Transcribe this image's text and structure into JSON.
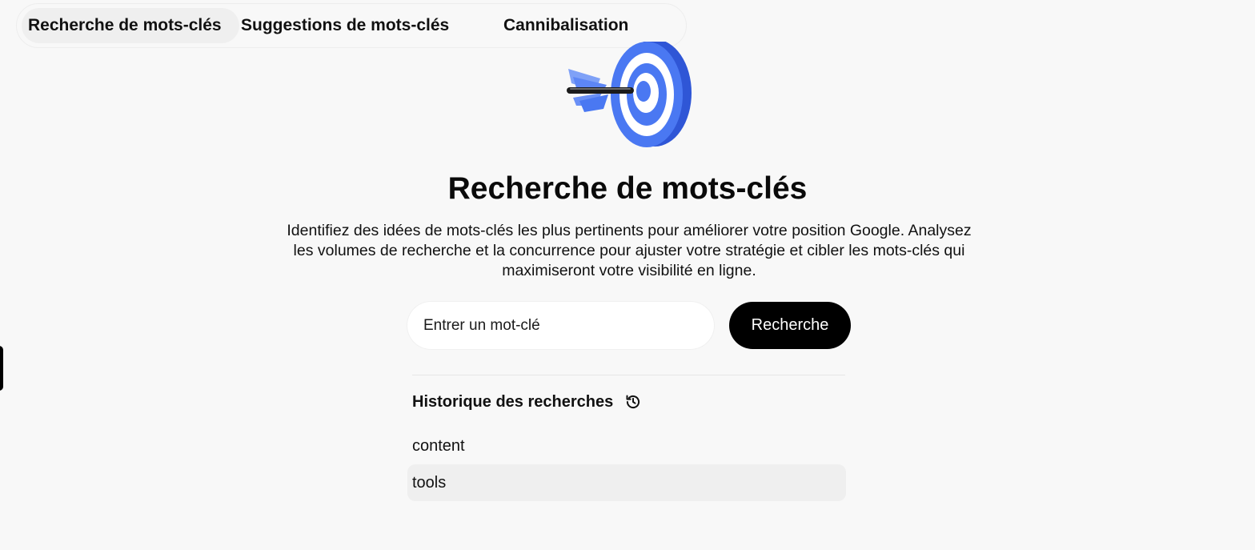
{
  "tabs": [
    {
      "label": "Recherche de mots-clés",
      "active": true
    },
    {
      "label": "Suggestions de mots-clés",
      "active": false
    },
    {
      "label": "Cannibalisation",
      "active": false
    }
  ],
  "illustration": {
    "icon": "target-arrow-icon",
    "colors": {
      "blue": "#3f6ef0",
      "white": "#ffffff",
      "dark": "#1b1b1b"
    }
  },
  "main": {
    "title": "Recherche de mots-clés",
    "description": "Identifiez des idées de mots-clés les plus pertinents pour améliorer votre position Google. Analysez les volumes de recherche et la concurrence pour ajuster votre stratégie et cibler les mots-clés qui maximiseront votre visibilité en ligne."
  },
  "search": {
    "placeholder": "Entrer un mot-clé",
    "value": "",
    "button_label": "Recherche"
  },
  "history": {
    "title": "Historique des recherches",
    "icon": "history-icon",
    "items": [
      "content",
      "tools"
    ]
  },
  "colors": {
    "accent": "#000000",
    "background": "#f8f8f8",
    "hover": "#efefef"
  }
}
